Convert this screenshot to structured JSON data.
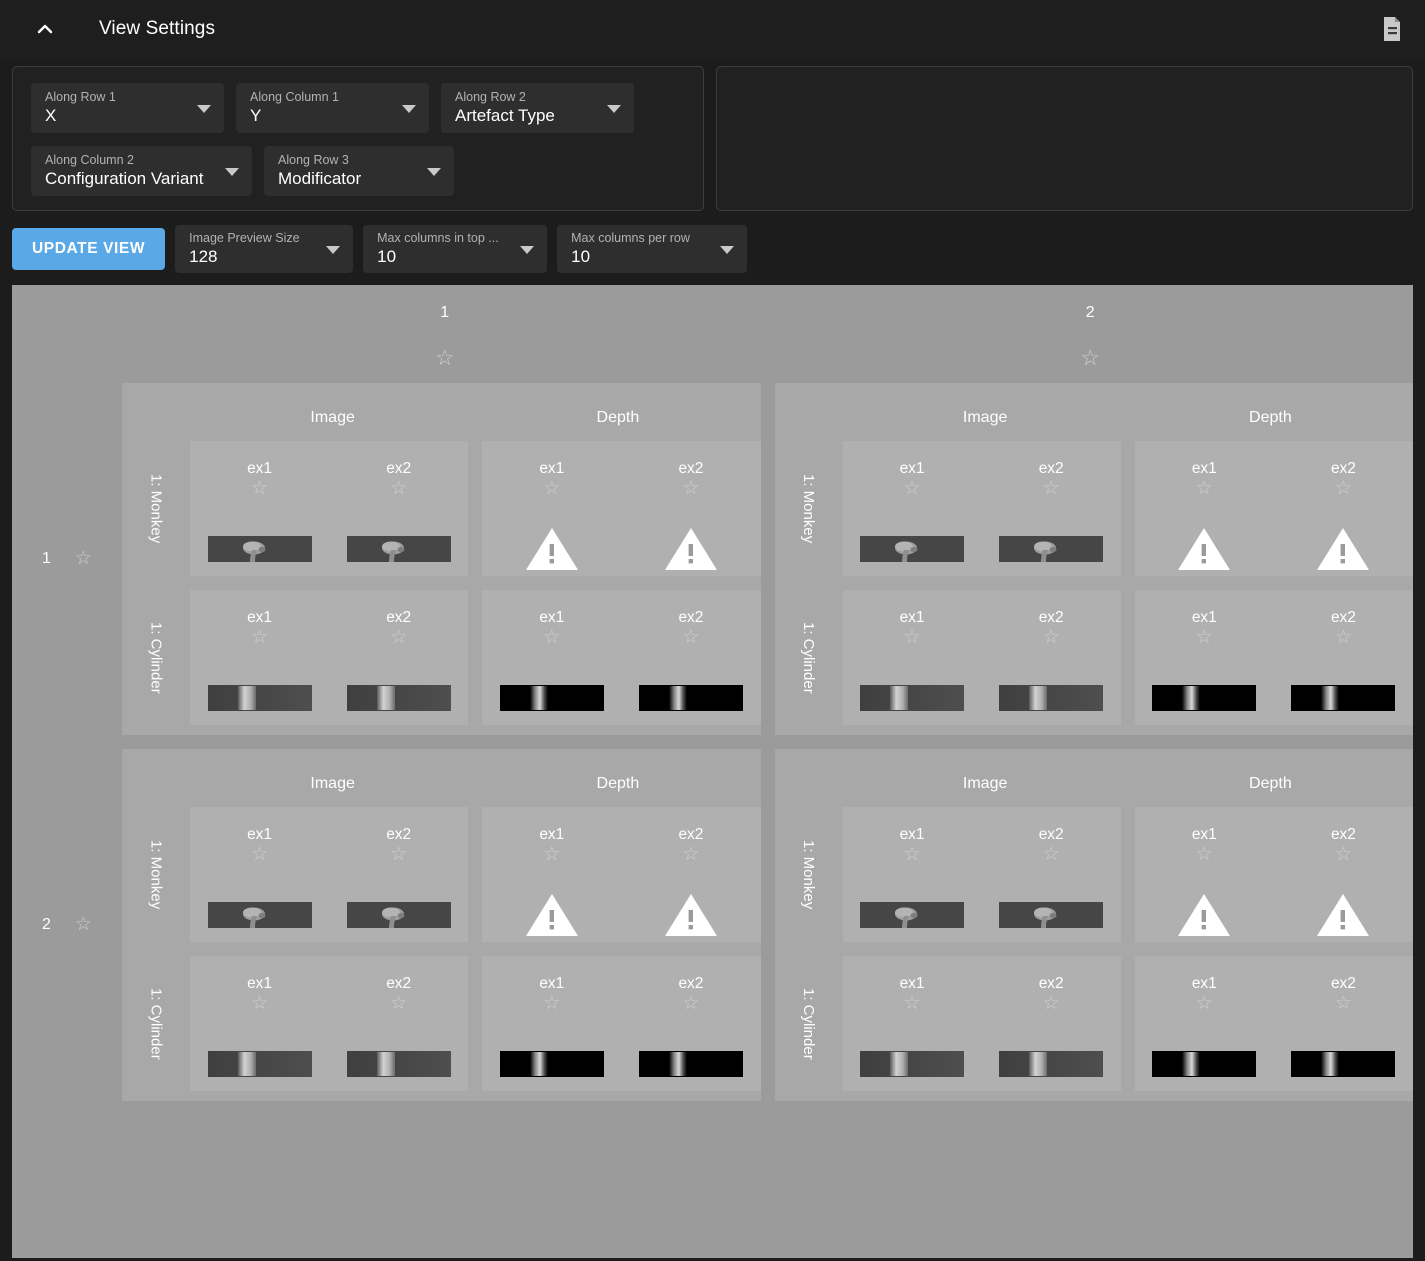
{
  "header": {
    "title": "View Settings",
    "collapse_icon": "chevron-up-icon",
    "doc_icon": "document-icon"
  },
  "settings": {
    "selects": [
      {
        "label": "Along Row 1",
        "value": "X"
      },
      {
        "label": "Along Column 1",
        "value": "Y"
      },
      {
        "label": "Along Row 2",
        "value": "Artefact Type"
      },
      {
        "label": "Along Column 2",
        "value": "Configuration Variant"
      },
      {
        "label": "Along Row 3",
        "value": "Modificator"
      }
    ]
  },
  "actions": {
    "update_label": "UPDATE VIEW",
    "controls": [
      {
        "label": "Image Preview Size",
        "value": "128"
      },
      {
        "label": "Max columns in top ...",
        "value": "10"
      },
      {
        "label": "Max columns per row",
        "value": "10"
      }
    ]
  },
  "grid": {
    "top_columns": [
      {
        "num": "1",
        "star": "star-icon"
      },
      {
        "num": "2",
        "star": "star-icon"
      }
    ],
    "row_headers": [
      {
        "num": "1",
        "star": "star-icon"
      },
      {
        "num": "2",
        "star": "star-icon"
      }
    ],
    "artefact_types": [
      "Image",
      "Depth"
    ],
    "configuration_variants": [
      "1: Monkey",
      "1: Cylinder"
    ],
    "modificators": [
      "ex1",
      "ex2"
    ],
    "cell_star": "star-icon",
    "thumbnails": {
      "monkey_image": "monkey-render-thumbnail",
      "monkey_depth": "warning-triangle-icon",
      "cylinder_image": "cylinder-render-thumbnail",
      "cylinder_depth": "cylinder-depth-thumbnail"
    }
  },
  "colors": {
    "accent": "#5aa9e6",
    "header_bg": "#1e1e1e",
    "panel_bg": "#212121",
    "select_bg": "#2e2e2e",
    "viewport_bg": "#9b9b9b",
    "block_bg": "#a8a8a8",
    "cell_bg": "#b0b0b0"
  }
}
